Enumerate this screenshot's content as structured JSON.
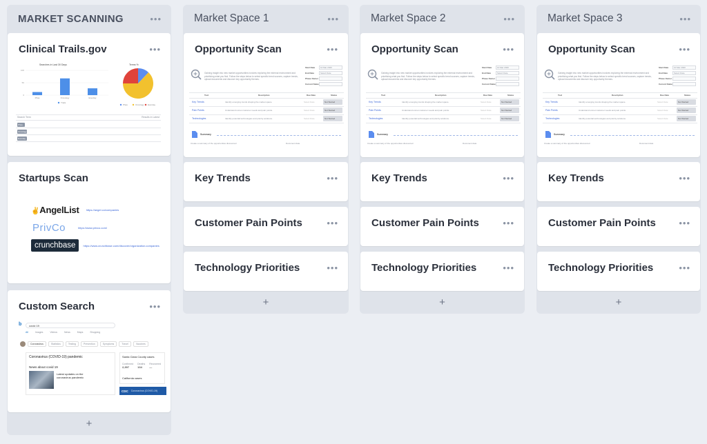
{
  "columns": [
    {
      "title": "MARKET SCANNING",
      "cards": [
        {
          "title": "Clinical Trails.gov",
          "preview": {
            "bar_chart_title": "Searches in Last 30 Days",
            "bar_categories": [
              "Phas",
              "Oncology",
              "Everday"
            ],
            "bar_values": [
              5,
              27,
              11
            ],
            "bar_y_ticks": [
              "100",
              "50",
              "0"
            ],
            "legend_label": "Trials",
            "pie_title": "Terms %",
            "pie_segments": [
              {
                "label": "Phas",
                "value": 12,
                "color": "#5b8def"
              },
              {
                "label": "Oncology",
                "value": 63,
                "color": "#f2c12e"
              },
              {
                "label": "Everday",
                "value": 25,
                "color": "#e0433b"
              }
            ],
            "table_header_left": "Search Term",
            "table_header_right": "Results in Latest",
            "table_rows": [
              "Phas",
              "Oncology",
              "Everday"
            ]
          }
        },
        {
          "title": "Startups Scan",
          "links": [
            {
              "logo": "AngelList",
              "url": "https://angel.co/companies"
            },
            {
              "logo": "PrivCo",
              "url": "https://www.privco.com/"
            },
            {
              "logo": "crunchbase",
              "url": "https://www.crunchbase.com/discover/organization.companies"
            }
          ]
        },
        {
          "title": "Custom Search",
          "preview": {
            "query": "covid 19",
            "tabs": [
              "All",
              "Images",
              "Videos",
              "News",
              "Maps",
              "Shopping"
            ],
            "chips": [
              "Coronavirus",
              "Statistics",
              "Testing",
              "Prevention",
              "Symptoms",
              "Travel",
              "Vaccines"
            ],
            "result_title": "Coronavirus (COVID-19) pandemic",
            "news_title": "News about covid 19",
            "news_headline": "Latest updates on the coronavirus pandemic",
            "side_title": "Santa Clara County cases",
            "stats": [
              {
                "label": "Confirmed",
                "value": "2,397"
              },
              {
                "label": "Deaths",
                "value": "134"
              },
              {
                "label": "Recovered",
                "value": "—"
              }
            ],
            "side_title2": "California cases",
            "cdc_label": "CDC",
            "cdc_text": "Coronavirus (COVID-19)"
          }
        }
      ],
      "add_label": "+"
    },
    {
      "title": "Market Space 1",
      "cards": [
        {
          "title": "Opportunity Scan"
        },
        {
          "title": "Key Trends"
        },
        {
          "title": "Customer Pain Points"
        },
        {
          "title": "Technology Priorities"
        }
      ],
      "add_label": "+"
    },
    {
      "title": "Market Space 2",
      "cards": [
        {
          "title": "Opportunity Scan"
        },
        {
          "title": "Key Trends"
        },
        {
          "title": "Customer Pain Points"
        },
        {
          "title": "Technology Priorities"
        }
      ],
      "add_label": "+"
    },
    {
      "title": "Market Space 3",
      "cards": [
        {
          "title": "Opportunity Scan"
        },
        {
          "title": "Key Trends"
        },
        {
          "title": "Customer Pain Points"
        },
        {
          "title": "Technology Priorities"
        }
      ],
      "add_label": "+"
    }
  ],
  "opportunity_preview": {
    "intro": "Gaining insight into new market opportunities involves exploring the external environment and prioritizing what you find. Follow the steps below to select specific trend sources, capture trends, upload documents and discover key opportunity themes.",
    "side_fields": [
      "Start Date",
      "End Date",
      "Phase Owner",
      "Current Status"
    ],
    "side_values": [
      "10 Mar 2020",
      "Select Date",
      "",
      ""
    ],
    "table_headers": [
      "Tool",
      "Description",
      "Due Date",
      "Status"
    ],
    "rows": [
      {
        "tool": "Key Trends",
        "desc": "Identify emerging trends shaping the market space.",
        "due": "Select Date",
        "status": "Not Started"
      },
      {
        "tool": "Pain Points",
        "desc": "Understand unmet customer needs and pain points.",
        "due": "Select Date",
        "status": "Not Started"
      },
      {
        "tool": "Technologies",
        "desc": "Identify potential technologies and priority solutions.",
        "due": "Select Date",
        "status": "Not Started"
      }
    ],
    "summary_label": "Summary",
    "summary_text": "Create a summary of the opportunities discovered",
    "footer_text": "Document date"
  },
  "icons": {
    "menu": "ellipsis-icon",
    "search": "magnifier-icon",
    "doc": "document-icon"
  }
}
